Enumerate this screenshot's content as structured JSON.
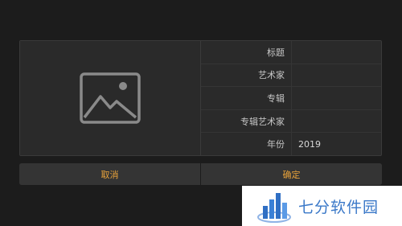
{
  "dialog": {
    "artwork": {
      "icon": "image-placeholder-icon"
    },
    "fields": [
      {
        "label": "标题",
        "value": ""
      },
      {
        "label": "艺术家",
        "value": ""
      },
      {
        "label": "专辑",
        "value": ""
      },
      {
        "label": "专辑艺术家",
        "value": ""
      },
      {
        "label": "年份",
        "value": "2019"
      }
    ],
    "buttons": {
      "cancel": "取消",
      "confirm": "确定"
    },
    "accent": "#e8a23a"
  },
  "watermark": {
    "text": "七分软件园"
  }
}
